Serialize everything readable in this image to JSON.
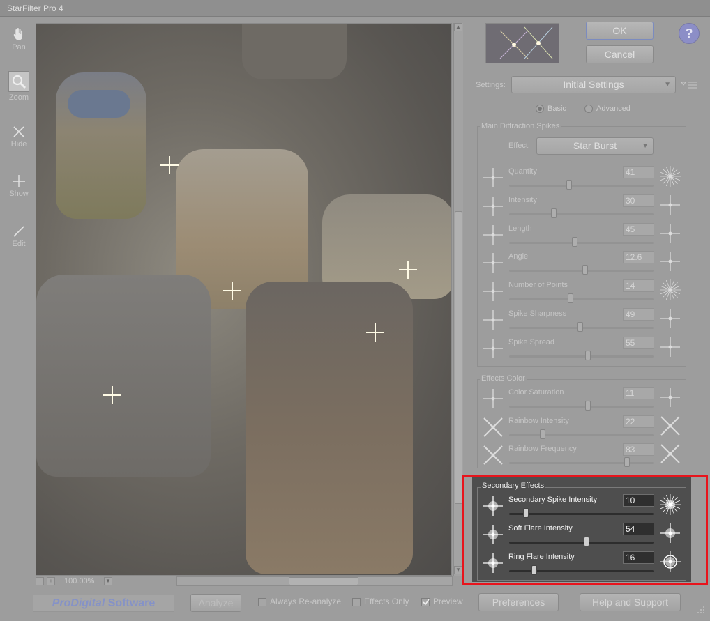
{
  "window": {
    "title": "StarFilter Pro 4"
  },
  "tools": [
    {
      "label": "Pan",
      "icon": "hand-icon"
    },
    {
      "label": "Zoom",
      "icon": "magnifier-icon"
    },
    {
      "label": "Hide",
      "icon": "x-cross-icon"
    },
    {
      "label": "Show",
      "icon": "plus-cross-icon"
    },
    {
      "label": "Edit",
      "icon": "pen-icon"
    }
  ],
  "preview": {
    "zoom": "100.00%"
  },
  "dialog": {
    "ok": "OK",
    "cancel": "Cancel",
    "help": "?"
  },
  "settings": {
    "label": "Settings:",
    "value": "Initial Settings",
    "mode_basic": "Basic",
    "mode_advanced": "Advanced",
    "selected_mode": "Basic"
  },
  "main_spikes": {
    "title": "Main Diffraction Spikes",
    "effect_label": "Effect:",
    "effect_value": "Star Burst",
    "params": [
      {
        "label": "Quantity",
        "value": "41",
        "pct": 0.41
      },
      {
        "label": "Intensity",
        "value": "30",
        "pct": 0.3
      },
      {
        "label": "Length",
        "value": "45",
        "pct": 0.45
      },
      {
        "label": "Angle",
        "value": "12.6",
        "pct": 0.53
      },
      {
        "label": "Number of Points",
        "value": "14",
        "pct": 0.42
      },
      {
        "label": "Spike Sharpness",
        "value": "49",
        "pct": 0.49
      },
      {
        "label": "Spike Spread",
        "value": "55",
        "pct": 0.55
      }
    ]
  },
  "effects_color": {
    "title": "Effects Color",
    "params": [
      {
        "label": "Color Saturation",
        "value": "11",
        "pct": 0.55
      },
      {
        "label": "Rainbow Intensity",
        "value": "22",
        "pct": 0.22
      },
      {
        "label": "Rainbow Frequency",
        "value": "83",
        "pct": 0.83
      }
    ]
  },
  "secondary_effects": {
    "title": "Secondary Effects",
    "params": [
      {
        "label": "Secondary Spike Intensity",
        "value": "10",
        "pct": 0.1
      },
      {
        "label": "Soft Flare Intensity",
        "value": "54",
        "pct": 0.54
      },
      {
        "label": "Ring Flare Intensity",
        "value": "16",
        "pct": 0.16
      }
    ]
  },
  "footer": {
    "logo_a": "ProDigital",
    "logo_b": " Software",
    "analyze": "Analyze",
    "always_reanalyze": "Always Re-analyze",
    "effects_only": "Effects Only",
    "preview": "Preview",
    "preview_checked": true,
    "preferences": "Preferences",
    "help_support": "Help and Support"
  },
  "colors": {
    "highlight_border": "#e8141c",
    "active_panel": "#4e4e4e",
    "help_icon": "#8c8ec7"
  }
}
